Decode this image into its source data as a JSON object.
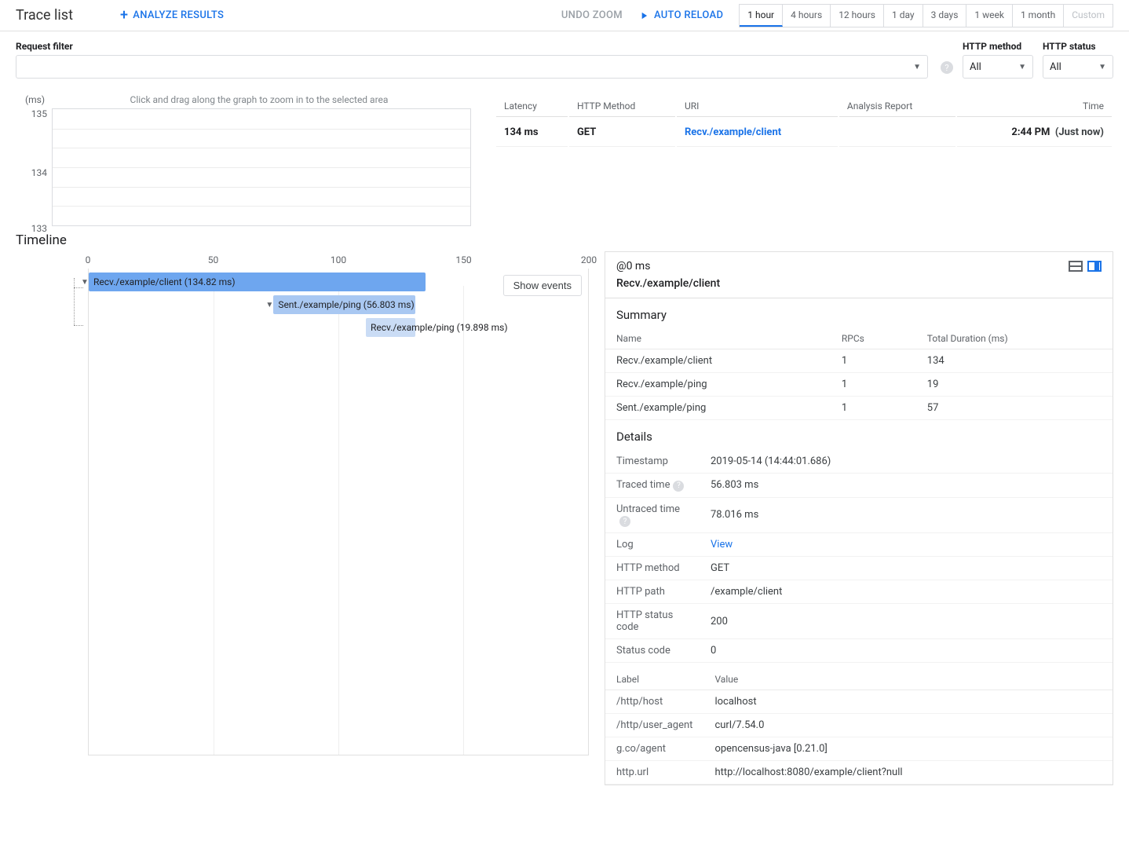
{
  "header": {
    "title": "Trace list",
    "analyze": "ANALYZE RESULTS",
    "undo_zoom": "UNDO ZOOM",
    "auto_reload": "AUTO RELOAD",
    "time_ranges": [
      "1 hour",
      "4 hours",
      "12 hours",
      "1 day",
      "3 days",
      "1 week",
      "1 month",
      "Custom"
    ],
    "active_range": "1 hour"
  },
  "filters": {
    "request_filter_label": "Request filter",
    "http_method_label": "HTTP method",
    "http_method_value": "All",
    "http_status_label": "HTTP status",
    "http_status_value": "All"
  },
  "graph": {
    "unit": "(ms)",
    "hint": "Click and drag along the graph to zoom in to the selected area",
    "y_ticks": [
      "135",
      "134",
      "133"
    ]
  },
  "trace_table": {
    "headers": {
      "latency": "Latency",
      "method": "HTTP Method",
      "uri": "URI",
      "analysis": "Analysis Report",
      "time": "Time"
    },
    "row": {
      "latency": "134 ms",
      "method": "GET",
      "uri": "Recv./example/client",
      "time": "2:44 PM",
      "time_rel": "(Just now)"
    }
  },
  "timeline": {
    "title": "Timeline",
    "axis_ticks": [
      "0",
      "50",
      "100",
      "150",
      "200"
    ],
    "show_events": "Show events",
    "spans": [
      {
        "label": "Recv./example/client (134.82 ms)",
        "left_pct": 0,
        "width_pct": 67.4,
        "cls": "b1",
        "collapsible": true
      },
      {
        "label": "Sent./example/ping (56.803 ms)",
        "left_pct": 37.0,
        "width_pct": 28.4,
        "cls": "b2",
        "collapsible": true
      },
      {
        "label": "Recv./example/ping (19.898 ms)",
        "left_pct": 55.5,
        "width_pct": 9.9,
        "cls": "b3",
        "collapsible": false
      }
    ]
  },
  "panel": {
    "at": "@0 ms",
    "span_title": "Recv./example/client",
    "summary_title": "Summary",
    "summary_headers": {
      "name": "Name",
      "rpcs": "RPCs",
      "total": "Total Duration (ms)"
    },
    "summary_rows": [
      {
        "name": "Recv./example/client",
        "rpcs": "1",
        "total": "134"
      },
      {
        "name": "Recv./example/ping",
        "rpcs": "1",
        "total": "19"
      },
      {
        "name": "Sent./example/ping",
        "rpcs": "1",
        "total": "57"
      }
    ],
    "details_title": "Details",
    "details": {
      "timestamp_k": "Timestamp",
      "timestamp_v": "2019-05-14 (14:44:01.686)",
      "traced_k": "Traced time",
      "traced_v": "56.803 ms",
      "untraced_k": "Untraced time",
      "untraced_v": "78.016 ms",
      "log_k": "Log",
      "log_v": "View",
      "httpmethod_k": "HTTP method",
      "httpmethod_v": "GET",
      "httppath_k": "HTTP path",
      "httppath_v": "/example/client",
      "httpstatus_k": "HTTP status code",
      "httpstatus_v": "200",
      "status_k": "Status code",
      "status_v": "0"
    },
    "labels_headers": {
      "label": "Label",
      "value": "Value"
    },
    "labels": [
      {
        "k": "/http/host",
        "v": "localhost"
      },
      {
        "k": "/http/user_agent",
        "v": "curl/7.54.0"
      },
      {
        "k": "g.co/agent",
        "v": "opencensus-java [0.21.0]"
      },
      {
        "k": "http.url",
        "v": "http://localhost:8080/example/client?null"
      }
    ]
  },
  "chart_data": {
    "type": "scatter",
    "title": "",
    "ylabel": "(ms)",
    "ylim": [
      133,
      135
    ],
    "y_ticks": [
      133,
      134,
      135
    ],
    "hint": "Click and drag along the graph to zoom in to the selected area",
    "series": [
      {
        "name": "latency",
        "x": [],
        "y": []
      }
    ]
  }
}
